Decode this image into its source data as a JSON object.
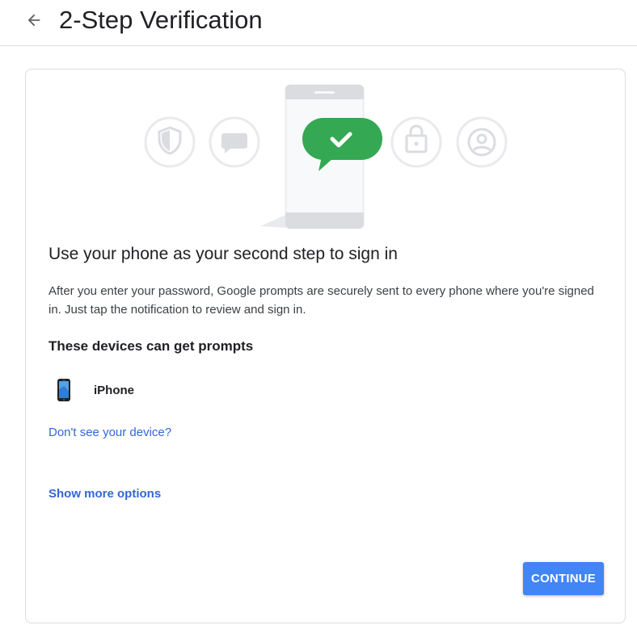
{
  "header": {
    "back_icon": "arrow-back-icon",
    "title": "2-Step Verification"
  },
  "illustration": {
    "icons": [
      "shield-icon",
      "chat-bubble-icon",
      "phone-icon",
      "checkmark-bubble-icon",
      "lock-icon",
      "account-circle-icon"
    ],
    "accent_color": "#34a853"
  },
  "main": {
    "heading": "Use your phone as your second step to sign in",
    "description": "After you enter your password, Google prompts are securely sent to every phone where you're signed in. Just tap the notification to review and sign in.",
    "devices_heading": "These devices can get prompts",
    "devices": [
      {
        "name": "iPhone",
        "icon": "iphone-icon"
      }
    ],
    "missing_device_link": "Don't see your device?",
    "more_options_link": "Show more options",
    "continue_label": "CONTINUE"
  },
  "colors": {
    "primary": "#4285f4",
    "link": "#3367d6",
    "border": "#dadce0",
    "text": "#202124"
  }
}
